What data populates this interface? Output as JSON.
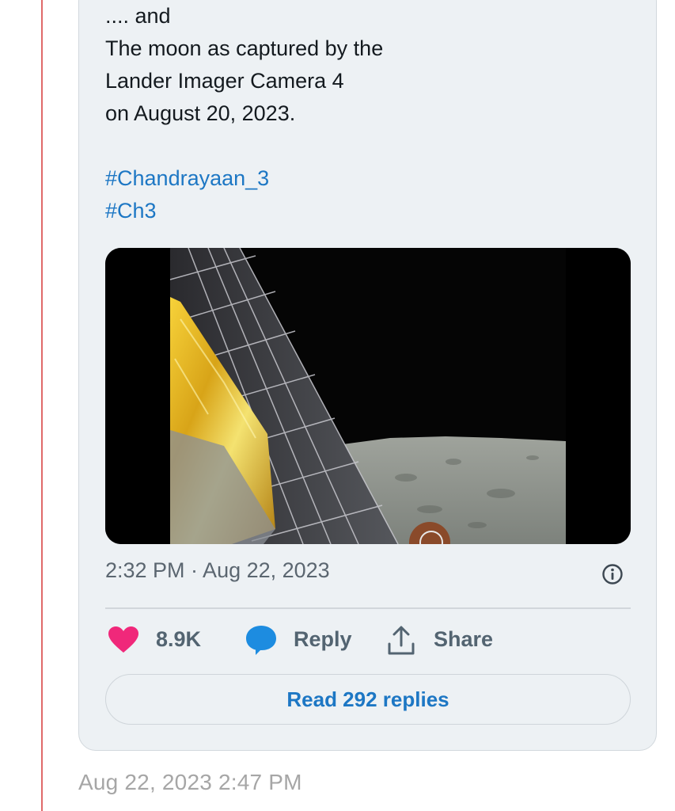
{
  "tweet": {
    "text_lines": [
      ".... and",
      "The moon as captured by the",
      "Lander Imager Camera 4",
      "on August 20, 2023."
    ],
    "hashtags": [
      "#Chandrayaan_3",
      "#Ch3"
    ],
    "timestamp": "2:32 PM · Aug 22, 2023",
    "likes": "8.9K",
    "reply_label": "Reply",
    "share_label": "Share",
    "read_replies_label": "Read 292 replies"
  },
  "post": {
    "date": "Aug 22, 2023 2:47 PM"
  },
  "colors": {
    "card_bg": "#edf1f4",
    "link": "#1d77c4",
    "like_pink": "#f0287a",
    "reply_blue": "#1d8ce0",
    "left_rule": "#e06a6a"
  },
  "icons": {
    "like": "heart-icon",
    "reply": "speech-bubble-icon",
    "share": "share-upload-icon",
    "info": "info-icon"
  }
}
